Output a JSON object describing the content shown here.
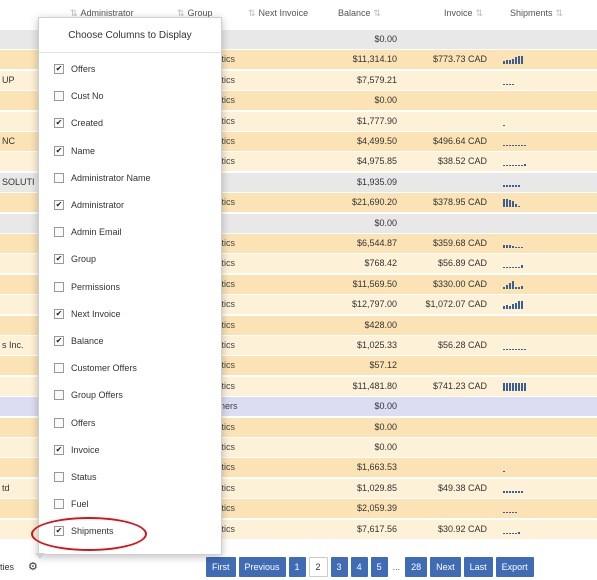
{
  "header": {
    "administrator": "Administrator",
    "group": "Group",
    "next_invoice": "Next Invoice",
    "balance": "Balance",
    "invoice": "Invoice",
    "shipments": "Shipments"
  },
  "rows": [
    {
      "left": "",
      "group": "",
      "balance": "$0.00",
      "invoice": "",
      "ship": [],
      "style": "gray"
    },
    {
      "left": "",
      "group": "gistics",
      "balance": "$11,314.10",
      "invoice": "$773.73 CAD",
      "ship": [
        3,
        4,
        4,
        5,
        7,
        8,
        8
      ],
      "style": "odd"
    },
    {
      "left": "UP",
      "group": "gistics",
      "balance": "$7,579.21",
      "invoice": "",
      "ship": [
        1,
        1,
        1,
        1
      ],
      "style": "even"
    },
    {
      "left": "",
      "group": "gistics",
      "balance": "$0.00",
      "invoice": "",
      "ship": [],
      "style": "odd"
    },
    {
      "left": "",
      "group": "gistics",
      "balance": "$1,777.90",
      "invoice": "",
      "ship": [
        1
      ],
      "style": "even"
    },
    {
      "left": "NC",
      "group": "gistics",
      "balance": "$4,499.50",
      "invoice": "$496.64 CAD",
      "ship": [
        1,
        1,
        1,
        1,
        1,
        1,
        1,
        1
      ],
      "style": "odd"
    },
    {
      "left": "",
      "group": "gistics",
      "balance": "$4,975.85",
      "invoice": "$38.52 CAD",
      "ship": [
        1,
        1,
        1,
        1,
        1,
        1,
        1,
        2
      ],
      "style": "even"
    },
    {
      "left": "SOLUTI",
      "group": "",
      "balance": "$1,935.09",
      "invoice": "",
      "ship": [
        2,
        2,
        2,
        2,
        2,
        2
      ],
      "style": "gray"
    },
    {
      "left": "",
      "group": "gistics",
      "balance": "$21,690.20",
      "invoice": "$378.95 CAD",
      "ship": [
        8,
        8,
        7,
        6,
        3,
        1
      ],
      "style": "odd"
    },
    {
      "left": "",
      "group": "",
      "balance": "$0.00",
      "invoice": "",
      "ship": [],
      "style": "gray"
    },
    {
      "left": "",
      "group": "gistics",
      "balance": "$6,544.87",
      "invoice": "$359.68 CAD",
      "ship": [
        3,
        3,
        3,
        2,
        1,
        1,
        1
      ],
      "style": "odd"
    },
    {
      "left": "",
      "group": "gistics",
      "balance": "$768.42",
      "invoice": "$56.89 CAD",
      "ship": [
        1,
        1,
        1,
        1,
        1,
        1,
        3
      ],
      "style": "even"
    },
    {
      "left": "",
      "group": "gistics",
      "balance": "$11,569.50",
      "invoice": "$330.00 CAD",
      "ship": [
        2,
        4,
        6,
        8,
        2,
        2,
        3
      ],
      "style": "odd"
    },
    {
      "left": "",
      "group": "gistics",
      "balance": "$12,797.00",
      "invoice": "$1,072.07 CAD",
      "ship": [
        3,
        4,
        3,
        5,
        6,
        8,
        8
      ],
      "style": "even"
    },
    {
      "left": "",
      "group": "gistics",
      "balance": "$428.00",
      "invoice": "",
      "ship": [],
      "style": "odd"
    },
    {
      "left": "s Inc.",
      "group": "gistics",
      "balance": "$1,025.33",
      "invoice": "$56.28 CAD",
      "ship": [
        1,
        1,
        1,
        1,
        1,
        1,
        1,
        1
      ],
      "style": "even"
    },
    {
      "left": "",
      "group": "gistics",
      "balance": "$57.12",
      "invoice": "",
      "ship": [],
      "style": "odd"
    },
    {
      "left": "",
      "group": "gistics",
      "balance": "$11,481.80",
      "invoice": "$741.23 CAD",
      "ship": [
        8,
        8,
        8,
        8,
        8,
        8,
        8,
        8
      ],
      "style": "even"
    },
    {
      "left": "",
      "group": "tomers",
      "balance": "$0.00",
      "invoice": "",
      "ship": [],
      "style": "blue"
    },
    {
      "left": "",
      "group": "gistics",
      "balance": "$0.00",
      "invoice": "",
      "ship": [],
      "style": "odd"
    },
    {
      "left": "",
      "group": "gistics",
      "balance": "$0.00",
      "invoice": "",
      "ship": [],
      "style": "even"
    },
    {
      "left": "",
      "group": "gistics",
      "balance": "$1,663.53",
      "invoice": "",
      "ship": [
        1
      ],
      "style": "odd"
    },
    {
      "left": "td",
      "group": "gistics",
      "balance": "$1,029.85",
      "invoice": "$49.38 CAD",
      "ship": [
        2,
        2,
        2,
        2,
        2,
        2,
        2
      ],
      "style": "even"
    },
    {
      "left": "",
      "group": "gistics",
      "balance": "$2,059.39",
      "invoice": "",
      "ship": [
        1,
        1,
        1,
        1,
        1
      ],
      "style": "odd"
    },
    {
      "left": "",
      "group": "gistics",
      "balance": "$7,617.56",
      "invoice": "$30.92 CAD",
      "ship": [
        1,
        1,
        1,
        1,
        1,
        2
      ],
      "style": "even"
    }
  ],
  "footer": {
    "label": "ties",
    "gear_icon": "gear-icon"
  },
  "pager": {
    "first": "First",
    "previous": "Previous",
    "pages": [
      "1",
      "2",
      "3",
      "4",
      "5"
    ],
    "current": "2",
    "ellipsis": "...",
    "last_page": "28",
    "next": "Next",
    "last": "Last",
    "export": "Export"
  },
  "chooser": {
    "title": "Choose Columns to Display",
    "options": [
      {
        "label": "Offers",
        "checked": true
      },
      {
        "label": "Cust No",
        "checked": false
      },
      {
        "label": "Created",
        "checked": true
      },
      {
        "label": "Name",
        "checked": true
      },
      {
        "label": "Administrator Name",
        "checked": false
      },
      {
        "label": "Administrator",
        "checked": true
      },
      {
        "label": "Admin Email",
        "checked": false
      },
      {
        "label": "Group",
        "checked": true
      },
      {
        "label": "Permissions",
        "checked": false
      },
      {
        "label": "Next Invoice",
        "checked": true
      },
      {
        "label": "Balance",
        "checked": true
      },
      {
        "label": "Customer Offers",
        "checked": false
      },
      {
        "label": "Group Offers",
        "checked": false
      },
      {
        "label": "Offers",
        "checked": false
      },
      {
        "label": "Invoice",
        "checked": true
      },
      {
        "label": "Status",
        "checked": false
      },
      {
        "label": "Fuel",
        "checked": false
      },
      {
        "label": "Shipments",
        "checked": true
      }
    ]
  },
  "colors": {
    "row_odd": "#fbe3b5",
    "row_even": "#fdf1d8",
    "row_highlight": "#dcdcf3",
    "pager_blue": "#3f6cb5",
    "ring_red": "#d4141c",
    "bar_blue": "#3b5f94"
  }
}
